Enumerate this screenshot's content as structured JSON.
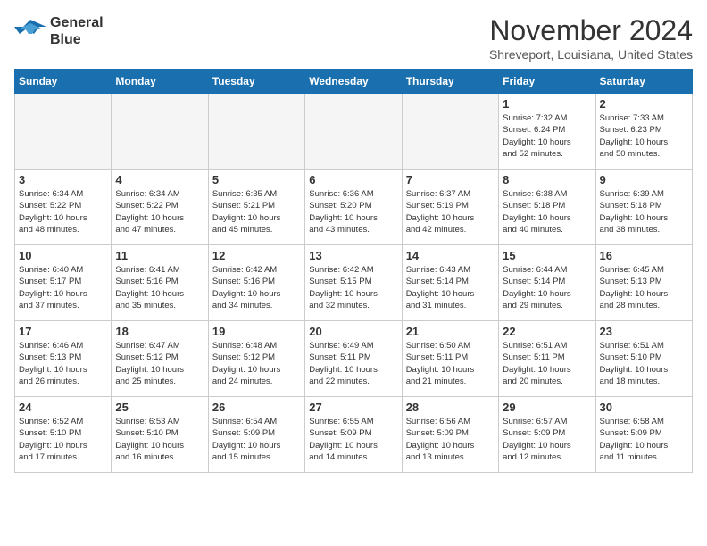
{
  "logo": {
    "line1": "General",
    "line2": "Blue"
  },
  "title": "November 2024",
  "subtitle": "Shreveport, Louisiana, United States",
  "days_of_week": [
    "Sunday",
    "Monday",
    "Tuesday",
    "Wednesday",
    "Thursday",
    "Friday",
    "Saturday"
  ],
  "weeks": [
    [
      {
        "day": "",
        "info": ""
      },
      {
        "day": "",
        "info": ""
      },
      {
        "day": "",
        "info": ""
      },
      {
        "day": "",
        "info": ""
      },
      {
        "day": "",
        "info": ""
      },
      {
        "day": "1",
        "info": "Sunrise: 7:32 AM\nSunset: 6:24 PM\nDaylight: 10 hours\nand 52 minutes."
      },
      {
        "day": "2",
        "info": "Sunrise: 7:33 AM\nSunset: 6:23 PM\nDaylight: 10 hours\nand 50 minutes."
      }
    ],
    [
      {
        "day": "3",
        "info": "Sunrise: 6:34 AM\nSunset: 5:22 PM\nDaylight: 10 hours\nand 48 minutes."
      },
      {
        "day": "4",
        "info": "Sunrise: 6:34 AM\nSunset: 5:22 PM\nDaylight: 10 hours\nand 47 minutes."
      },
      {
        "day": "5",
        "info": "Sunrise: 6:35 AM\nSunset: 5:21 PM\nDaylight: 10 hours\nand 45 minutes."
      },
      {
        "day": "6",
        "info": "Sunrise: 6:36 AM\nSunset: 5:20 PM\nDaylight: 10 hours\nand 43 minutes."
      },
      {
        "day": "7",
        "info": "Sunrise: 6:37 AM\nSunset: 5:19 PM\nDaylight: 10 hours\nand 42 minutes."
      },
      {
        "day": "8",
        "info": "Sunrise: 6:38 AM\nSunset: 5:18 PM\nDaylight: 10 hours\nand 40 minutes."
      },
      {
        "day": "9",
        "info": "Sunrise: 6:39 AM\nSunset: 5:18 PM\nDaylight: 10 hours\nand 38 minutes."
      }
    ],
    [
      {
        "day": "10",
        "info": "Sunrise: 6:40 AM\nSunset: 5:17 PM\nDaylight: 10 hours\nand 37 minutes."
      },
      {
        "day": "11",
        "info": "Sunrise: 6:41 AM\nSunset: 5:16 PM\nDaylight: 10 hours\nand 35 minutes."
      },
      {
        "day": "12",
        "info": "Sunrise: 6:42 AM\nSunset: 5:16 PM\nDaylight: 10 hours\nand 34 minutes."
      },
      {
        "day": "13",
        "info": "Sunrise: 6:42 AM\nSunset: 5:15 PM\nDaylight: 10 hours\nand 32 minutes."
      },
      {
        "day": "14",
        "info": "Sunrise: 6:43 AM\nSunset: 5:14 PM\nDaylight: 10 hours\nand 31 minutes."
      },
      {
        "day": "15",
        "info": "Sunrise: 6:44 AM\nSunset: 5:14 PM\nDaylight: 10 hours\nand 29 minutes."
      },
      {
        "day": "16",
        "info": "Sunrise: 6:45 AM\nSunset: 5:13 PM\nDaylight: 10 hours\nand 28 minutes."
      }
    ],
    [
      {
        "day": "17",
        "info": "Sunrise: 6:46 AM\nSunset: 5:13 PM\nDaylight: 10 hours\nand 26 minutes."
      },
      {
        "day": "18",
        "info": "Sunrise: 6:47 AM\nSunset: 5:12 PM\nDaylight: 10 hours\nand 25 minutes."
      },
      {
        "day": "19",
        "info": "Sunrise: 6:48 AM\nSunset: 5:12 PM\nDaylight: 10 hours\nand 24 minutes."
      },
      {
        "day": "20",
        "info": "Sunrise: 6:49 AM\nSunset: 5:11 PM\nDaylight: 10 hours\nand 22 minutes."
      },
      {
        "day": "21",
        "info": "Sunrise: 6:50 AM\nSunset: 5:11 PM\nDaylight: 10 hours\nand 21 minutes."
      },
      {
        "day": "22",
        "info": "Sunrise: 6:51 AM\nSunset: 5:11 PM\nDaylight: 10 hours\nand 20 minutes."
      },
      {
        "day": "23",
        "info": "Sunrise: 6:51 AM\nSunset: 5:10 PM\nDaylight: 10 hours\nand 18 minutes."
      }
    ],
    [
      {
        "day": "24",
        "info": "Sunrise: 6:52 AM\nSunset: 5:10 PM\nDaylight: 10 hours\nand 17 minutes."
      },
      {
        "day": "25",
        "info": "Sunrise: 6:53 AM\nSunset: 5:10 PM\nDaylight: 10 hours\nand 16 minutes."
      },
      {
        "day": "26",
        "info": "Sunrise: 6:54 AM\nSunset: 5:09 PM\nDaylight: 10 hours\nand 15 minutes."
      },
      {
        "day": "27",
        "info": "Sunrise: 6:55 AM\nSunset: 5:09 PM\nDaylight: 10 hours\nand 14 minutes."
      },
      {
        "day": "28",
        "info": "Sunrise: 6:56 AM\nSunset: 5:09 PM\nDaylight: 10 hours\nand 13 minutes."
      },
      {
        "day": "29",
        "info": "Sunrise: 6:57 AM\nSunset: 5:09 PM\nDaylight: 10 hours\nand 12 minutes."
      },
      {
        "day": "30",
        "info": "Sunrise: 6:58 AM\nSunset: 5:09 PM\nDaylight: 10 hours\nand 11 minutes."
      }
    ]
  ]
}
